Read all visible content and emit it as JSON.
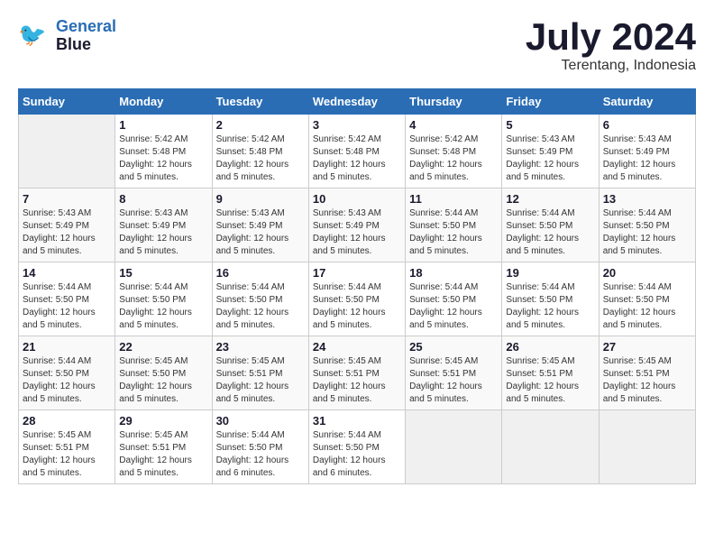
{
  "header": {
    "logo_line1": "General",
    "logo_line2": "Blue",
    "month_year": "July 2024",
    "location": "Terentang, Indonesia"
  },
  "weekdays": [
    "Sunday",
    "Monday",
    "Tuesday",
    "Wednesday",
    "Thursday",
    "Friday",
    "Saturday"
  ],
  "weeks": [
    [
      {
        "day": "",
        "info": ""
      },
      {
        "day": "1",
        "info": "Sunrise: 5:42 AM\nSunset: 5:48 PM\nDaylight: 12 hours\nand 5 minutes."
      },
      {
        "day": "2",
        "info": "Sunrise: 5:42 AM\nSunset: 5:48 PM\nDaylight: 12 hours\nand 5 minutes."
      },
      {
        "day": "3",
        "info": "Sunrise: 5:42 AM\nSunset: 5:48 PM\nDaylight: 12 hours\nand 5 minutes."
      },
      {
        "day": "4",
        "info": "Sunrise: 5:42 AM\nSunset: 5:48 PM\nDaylight: 12 hours\nand 5 minutes."
      },
      {
        "day": "5",
        "info": "Sunrise: 5:43 AM\nSunset: 5:49 PM\nDaylight: 12 hours\nand 5 minutes."
      },
      {
        "day": "6",
        "info": "Sunrise: 5:43 AM\nSunset: 5:49 PM\nDaylight: 12 hours\nand 5 minutes."
      }
    ],
    [
      {
        "day": "7",
        "info": "Sunrise: 5:43 AM\nSunset: 5:49 PM\nDaylight: 12 hours\nand 5 minutes."
      },
      {
        "day": "8",
        "info": "Sunrise: 5:43 AM\nSunset: 5:49 PM\nDaylight: 12 hours\nand 5 minutes."
      },
      {
        "day": "9",
        "info": "Sunrise: 5:43 AM\nSunset: 5:49 PM\nDaylight: 12 hours\nand 5 minutes."
      },
      {
        "day": "10",
        "info": "Sunrise: 5:43 AM\nSunset: 5:49 PM\nDaylight: 12 hours\nand 5 minutes."
      },
      {
        "day": "11",
        "info": "Sunrise: 5:44 AM\nSunset: 5:50 PM\nDaylight: 12 hours\nand 5 minutes."
      },
      {
        "day": "12",
        "info": "Sunrise: 5:44 AM\nSunset: 5:50 PM\nDaylight: 12 hours\nand 5 minutes."
      },
      {
        "day": "13",
        "info": "Sunrise: 5:44 AM\nSunset: 5:50 PM\nDaylight: 12 hours\nand 5 minutes."
      }
    ],
    [
      {
        "day": "14",
        "info": "Sunrise: 5:44 AM\nSunset: 5:50 PM\nDaylight: 12 hours\nand 5 minutes."
      },
      {
        "day": "15",
        "info": "Sunrise: 5:44 AM\nSunset: 5:50 PM\nDaylight: 12 hours\nand 5 minutes."
      },
      {
        "day": "16",
        "info": "Sunrise: 5:44 AM\nSunset: 5:50 PM\nDaylight: 12 hours\nand 5 minutes."
      },
      {
        "day": "17",
        "info": "Sunrise: 5:44 AM\nSunset: 5:50 PM\nDaylight: 12 hours\nand 5 minutes."
      },
      {
        "day": "18",
        "info": "Sunrise: 5:44 AM\nSunset: 5:50 PM\nDaylight: 12 hours\nand 5 minutes."
      },
      {
        "day": "19",
        "info": "Sunrise: 5:44 AM\nSunset: 5:50 PM\nDaylight: 12 hours\nand 5 minutes."
      },
      {
        "day": "20",
        "info": "Sunrise: 5:44 AM\nSunset: 5:50 PM\nDaylight: 12 hours\nand 5 minutes."
      }
    ],
    [
      {
        "day": "21",
        "info": "Sunrise: 5:44 AM\nSunset: 5:50 PM\nDaylight: 12 hours\nand 5 minutes."
      },
      {
        "day": "22",
        "info": "Sunrise: 5:45 AM\nSunset: 5:50 PM\nDaylight: 12 hours\nand 5 minutes."
      },
      {
        "day": "23",
        "info": "Sunrise: 5:45 AM\nSunset: 5:51 PM\nDaylight: 12 hours\nand 5 minutes."
      },
      {
        "day": "24",
        "info": "Sunrise: 5:45 AM\nSunset: 5:51 PM\nDaylight: 12 hours\nand 5 minutes."
      },
      {
        "day": "25",
        "info": "Sunrise: 5:45 AM\nSunset: 5:51 PM\nDaylight: 12 hours\nand 5 minutes."
      },
      {
        "day": "26",
        "info": "Sunrise: 5:45 AM\nSunset: 5:51 PM\nDaylight: 12 hours\nand 5 minutes."
      },
      {
        "day": "27",
        "info": "Sunrise: 5:45 AM\nSunset: 5:51 PM\nDaylight: 12 hours\nand 5 minutes."
      }
    ],
    [
      {
        "day": "28",
        "info": "Sunrise: 5:45 AM\nSunset: 5:51 PM\nDaylight: 12 hours\nand 5 minutes."
      },
      {
        "day": "29",
        "info": "Sunrise: 5:45 AM\nSunset: 5:51 PM\nDaylight: 12 hours\nand 5 minutes."
      },
      {
        "day": "30",
        "info": "Sunrise: 5:44 AM\nSunset: 5:50 PM\nDaylight: 12 hours\nand 6 minutes."
      },
      {
        "day": "31",
        "info": "Sunrise: 5:44 AM\nSunset: 5:50 PM\nDaylight: 12 hours\nand 6 minutes."
      },
      {
        "day": "",
        "info": ""
      },
      {
        "day": "",
        "info": ""
      },
      {
        "day": "",
        "info": ""
      }
    ]
  ]
}
